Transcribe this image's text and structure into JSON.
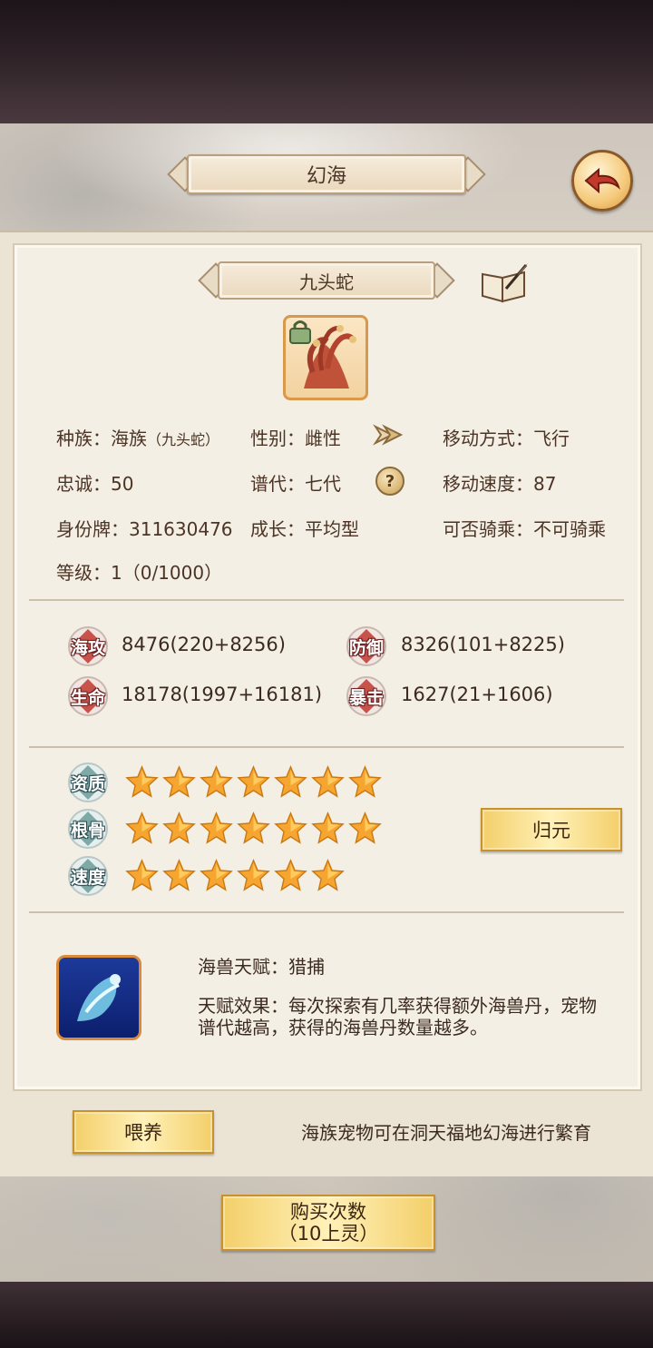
{
  "window": {
    "title": "幻海"
  },
  "pet": {
    "name": "九头蛇",
    "race_label": "种族：",
    "race_value": "海族",
    "race_sub": "（九头蛇）",
    "gender_label": "性别：",
    "gender_value": "雌性",
    "move_mode_label": "移动方式：",
    "move_mode_value": "飞行",
    "loyalty_label": "忠诚：",
    "loyalty_value": "50",
    "generation_label": "谱代：",
    "generation_value": "七代",
    "move_speed_label": "移动速度：",
    "move_speed_value": "87",
    "id_label": "身份牌：",
    "id_value": "311630476",
    "growth_label": "成长：",
    "growth_value": "平均型",
    "rideable_label": "可否骑乘：",
    "rideable_value": "不可骑乘",
    "level_label": "等级：",
    "level_value": "1（0/1000）"
  },
  "stats": {
    "sea_attack": {
      "label": "海攻",
      "value": "8476(220+8256)"
    },
    "defense": {
      "label": "防御",
      "value": "8326(101+8225)"
    },
    "hp": {
      "label": "生命",
      "value": "18178(1997+16181)"
    },
    "crit": {
      "label": "暴击",
      "value": "1627(21+1606)"
    }
  },
  "ratings": {
    "aptitude": {
      "label": "资质",
      "stars": 7
    },
    "root": {
      "label": "根骨",
      "stars": 7
    },
    "speed": {
      "label": "速度",
      "stars": 6
    }
  },
  "buttons": {
    "reset": "归元",
    "feed": "喂养",
    "buy_line1": "购买次数",
    "buy_line2": "（10上灵）"
  },
  "talent": {
    "name_label": "海兽天赋：",
    "name_value": "猎捕",
    "effect_label": "天赋效果：",
    "effect_text": "每次探索有几率获得额外海兽丹，宠物谱代越高，获得的海兽丹数量越多。"
  },
  "note": "海族宠物可在洞天福地幻海进行繁育",
  "icons": [
    "back-arrow-icon",
    "book-quill-icon",
    "lock-icon",
    "arrow-right-icon",
    "question-icon",
    "star-icon",
    "skill-icon"
  ],
  "colors": {
    "text": "#4b3425",
    "badge_red": "#c8534b",
    "badge_teal": "#7fa9a6",
    "gold": "#f3cf6a",
    "star": "#f7a531"
  }
}
